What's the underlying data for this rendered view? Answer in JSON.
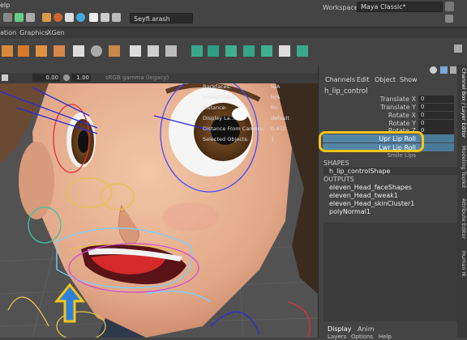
{
  "menu": {
    "help": "elp"
  },
  "status": {
    "user": "Seyfi.arash",
    "workspace_label": "Workspace:",
    "workspace_value": "Maya Classic*"
  },
  "shelf": {
    "tabs": [
      "ation",
      "Graphics",
      "XGen"
    ]
  },
  "viewport": {
    "toolbar": {
      "value1": "0.00",
      "value2": "1.00",
      "colorspace": "sRGB gamma (legacy)"
    },
    "hud": {
      "labels": [
        "Backfaces:",
        "Smoothness:",
        "Instance:",
        "Display La...",
        "Distance From Camera:",
        "Selected Objects:"
      ],
      "values": [
        "N/A",
        "N/A",
        "No",
        "default",
        "0.472",
        "1"
      ]
    }
  },
  "channel_box": {
    "menu": [
      "Channels",
      "Edit",
      "Object",
      "Show"
    ],
    "node": "h_lip_control",
    "attributes": [
      {
        "label": "Translate X",
        "value": "0"
      },
      {
        "label": "Translate Y",
        "value": "0"
      },
      {
        "label": "Rotate X",
        "value": "0"
      },
      {
        "label": "Rotate Y",
        "value": "0"
      },
      {
        "label": "Rotate Z",
        "value": "0"
      }
    ],
    "highlighted": [
      {
        "label": "Upr Lip Roll",
        "value": ""
      },
      {
        "label": "Lwr Lip Roll",
        "value": ""
      }
    ],
    "partial_attr": "Smile Lips",
    "shapes_header": "SHAPES",
    "shape": "h_lip_controlShape",
    "outputs_header": "OUTPUTS",
    "outputs": [
      "eleven_Head_faceShapes",
      "eleven_Head_tweak1",
      "eleven_Head_skinCluster1",
      "polyNormal1"
    ],
    "bottom_tabs": [
      "Display",
      "Anim"
    ],
    "bottom_menu": [
      "Layers",
      "Options",
      "Help"
    ]
  },
  "side_tabs": [
    "Channel Box / Layer Editor",
    "Modeling Toolkit",
    "Attribute Editor",
    "Human IK"
  ],
  "colors": {
    "accent_highlight": "#f5c518",
    "selection_blue": "#5285a6",
    "arrow_blue": "#2f7fd8",
    "arrow_yellow": "#f5c518"
  }
}
